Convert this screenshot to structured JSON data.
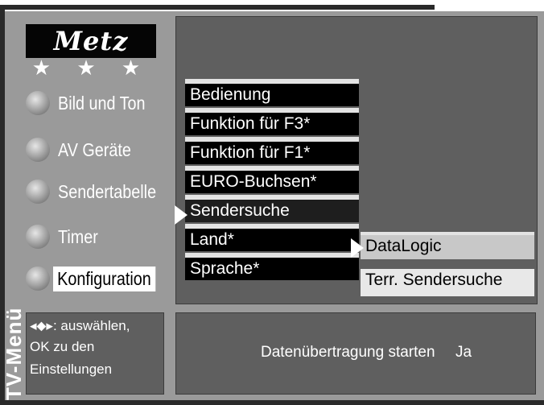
{
  "logo": {
    "brand": "Metz",
    "stars": "★ ★ ★"
  },
  "menu": {
    "items": [
      {
        "label": "Bild und Ton",
        "active": false
      },
      {
        "label": "AV Geräte",
        "active": false
      },
      {
        "label": "Sendertabelle",
        "active": false
      },
      {
        "label": "Timer",
        "active": false
      },
      {
        "label": "Konfiguration",
        "active": true
      }
    ]
  },
  "vertical_label": "TV-Menü",
  "submenu": {
    "items": [
      {
        "label": "Bedienung"
      },
      {
        "label": "Funktion für F3*"
      },
      {
        "label": "Funktion für F1*"
      },
      {
        "label": "EURO-Buchsen*"
      },
      {
        "label": "Sendersuche",
        "selected": true
      },
      {
        "label": "Land*"
      },
      {
        "label": "Sprache*"
      }
    ]
  },
  "subsubmenu": {
    "items": [
      {
        "label": "DataLogic",
        "selected": true
      },
      {
        "label": "Terr. Sendersuche"
      }
    ]
  },
  "help": {
    "nav_symbols": "◂⬥▸",
    "line1": ": auswählen,",
    "line2": "OK zu den",
    "line3": "Einstellungen"
  },
  "status": {
    "text": "Datenübertragung starten",
    "value": "Ja"
  },
  "colors": {
    "frame": "#9a9a9a",
    "panel": "#5f5f5f",
    "item_bg": "#000000",
    "selected_bg": "#c8c8c8"
  }
}
